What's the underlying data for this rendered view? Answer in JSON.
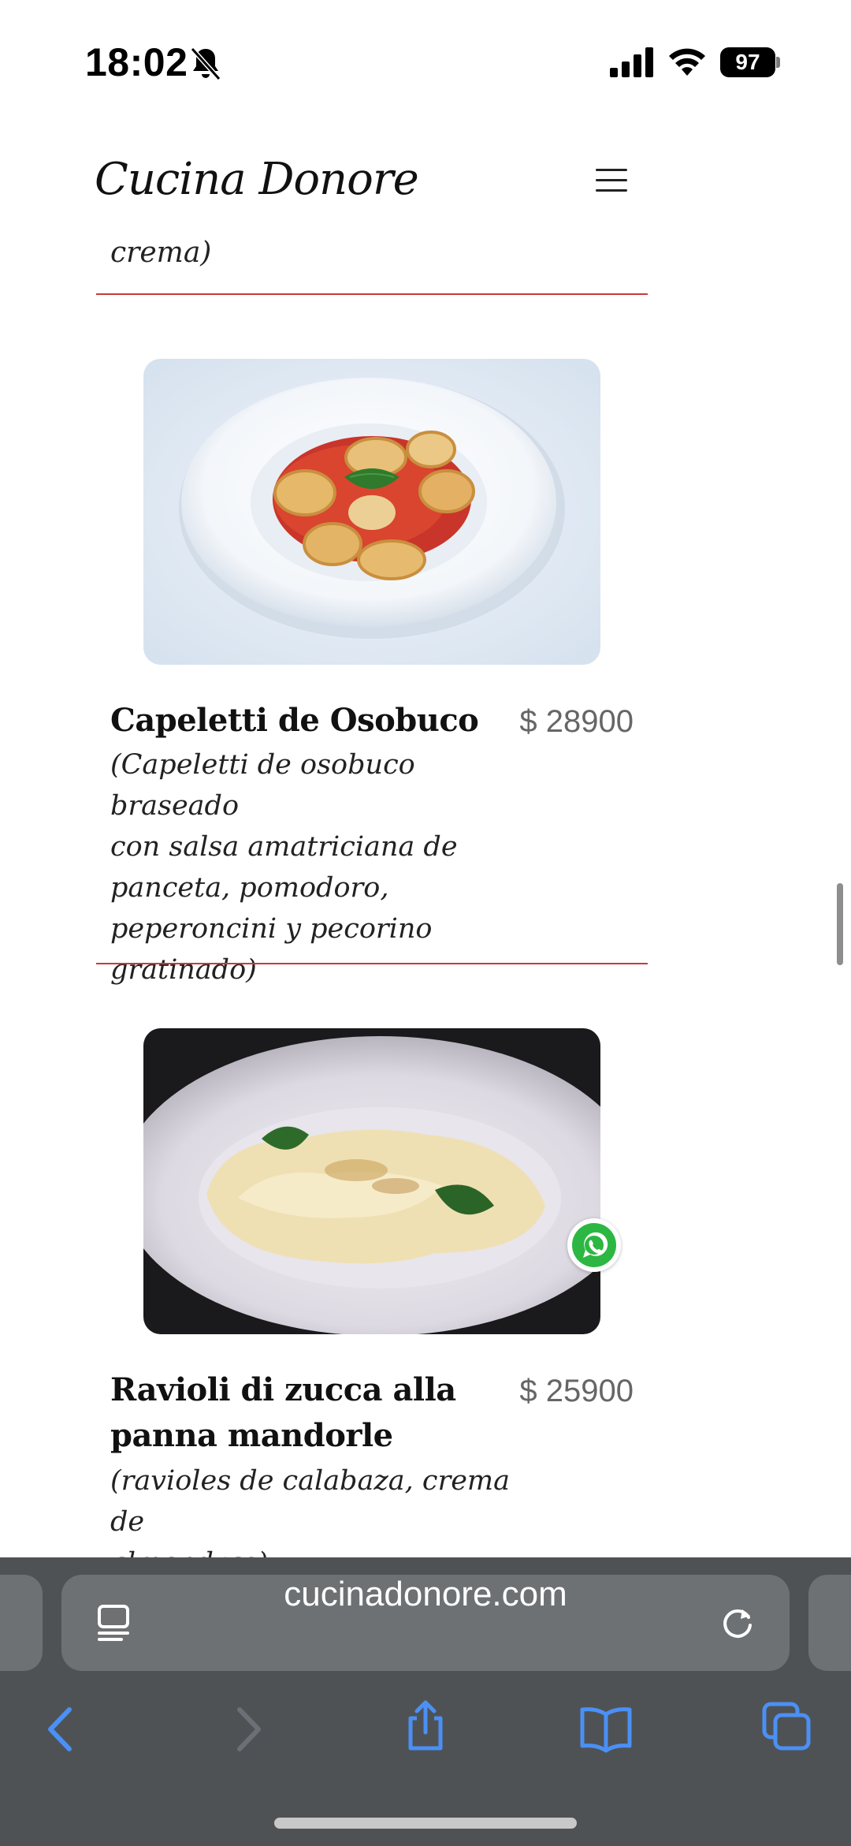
{
  "status_bar": {
    "time": "18:02",
    "battery": "97",
    "icons": [
      "bell-slash-icon",
      "signal-icon",
      "wifi-icon",
      "battery-icon"
    ]
  },
  "header": {
    "logo": "Cucina Donore",
    "menu_icon": "hamburger-menu-icon"
  },
  "previous_item": {
    "description_tail": "crema)"
  },
  "menu_items": [
    {
      "name": "Capeletti de Osobuco",
      "price": "$ 28900",
      "description": [
        "(Capeletti de osobuco braseado",
        "con salsa amatriciana de",
        "panceta, pomodoro,",
        "peperoncini y pecorino",
        "gratinado)"
      ],
      "photo": "capeletti-with-tomato-sauce-photo"
    },
    {
      "name": [
        "Ravioli di zucca alla",
        "panna mandorle"
      ],
      "price": "$ 25900",
      "description": [
        "(ravioles de calabaza, crema de",
        "almendras)"
      ],
      "photo": "ravioli-cream-sauce-photo"
    }
  ],
  "whatsapp": {
    "icon": "whatsapp-icon"
  },
  "browser": {
    "url": "cucinadonore.com",
    "icons": [
      "reader-icon",
      "reload-icon",
      "back-icon",
      "forward-icon",
      "share-icon",
      "bookmarks-icon",
      "tabs-icon"
    ],
    "accent": "#4a90f5"
  }
}
